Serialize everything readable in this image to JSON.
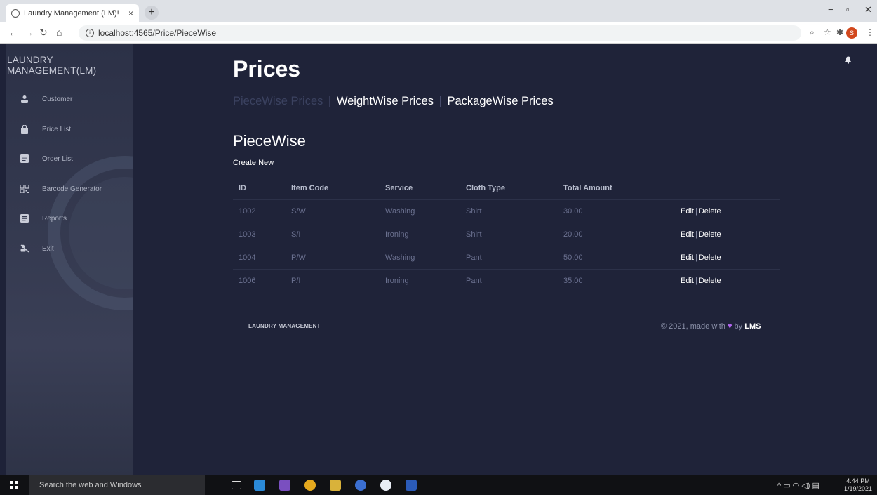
{
  "browser": {
    "tab_title": "Laundry Management (LM)!",
    "tab_close": "×",
    "new_tab": "+",
    "url": "localhost:4565/Price/PieceWise",
    "win_min": "−",
    "win_max": "▫",
    "win_close": "✕",
    "profile_initial": "S"
  },
  "sidebar": {
    "brand": "LAUNDRY MANAGEMENT(LM)",
    "items": [
      {
        "label": "Customer",
        "icon": "user-icon"
      },
      {
        "label": "Price List",
        "icon": "shopping-bag-icon"
      },
      {
        "label": "Order List",
        "icon": "list-icon"
      },
      {
        "label": "Barcode Generator",
        "icon": "qrcode-icon"
      },
      {
        "label": "Reports",
        "icon": "report-icon"
      },
      {
        "label": "Exit",
        "icon": "exit-icon"
      }
    ]
  },
  "main": {
    "title": "Prices",
    "subnav": {
      "piecewise": "PieceWise Prices",
      "weightwise": "WeightWise Prices",
      "packagewise": "PackageWise Prices",
      "separator": "|"
    },
    "section_title": "PieceWise",
    "create_new": "Create New",
    "table": {
      "headers": [
        "ID",
        "Item Code",
        "Service",
        "Cloth Type",
        "Total Amount"
      ],
      "rows": [
        {
          "id": "1002",
          "item_code": "S/W",
          "service": "Washing",
          "cloth_type": "Shirt",
          "total": "30.00"
        },
        {
          "id": "1003",
          "item_code": "S/I",
          "service": "Ironing",
          "cloth_type": "Shirt",
          "total": "20.00"
        },
        {
          "id": "1004",
          "item_code": "P/W",
          "service": "Washing",
          "cloth_type": "Pant",
          "total": "50.00"
        },
        {
          "id": "1006",
          "item_code": "P/I",
          "service": "Ironing",
          "cloth_type": "Pant",
          "total": "35.00"
        }
      ],
      "edit_label": "Edit",
      "delete_label": "Delete",
      "action_sep": "|"
    },
    "footer": {
      "left": "LAUNDRY MANAGEMENT",
      "right_prefix": "© 2021, made with",
      "heart": "♥",
      "by": "by",
      "right_brand": "LMS"
    }
  },
  "taskbar": {
    "search_placeholder": "Search the web and Windows",
    "time": "4:44 PM",
    "date": "1/19/2021"
  },
  "colors": {
    "background": "#1f2339",
    "sidebar": "#34394f",
    "heart": "#b266f0",
    "faded_link": "#3b4260"
  }
}
